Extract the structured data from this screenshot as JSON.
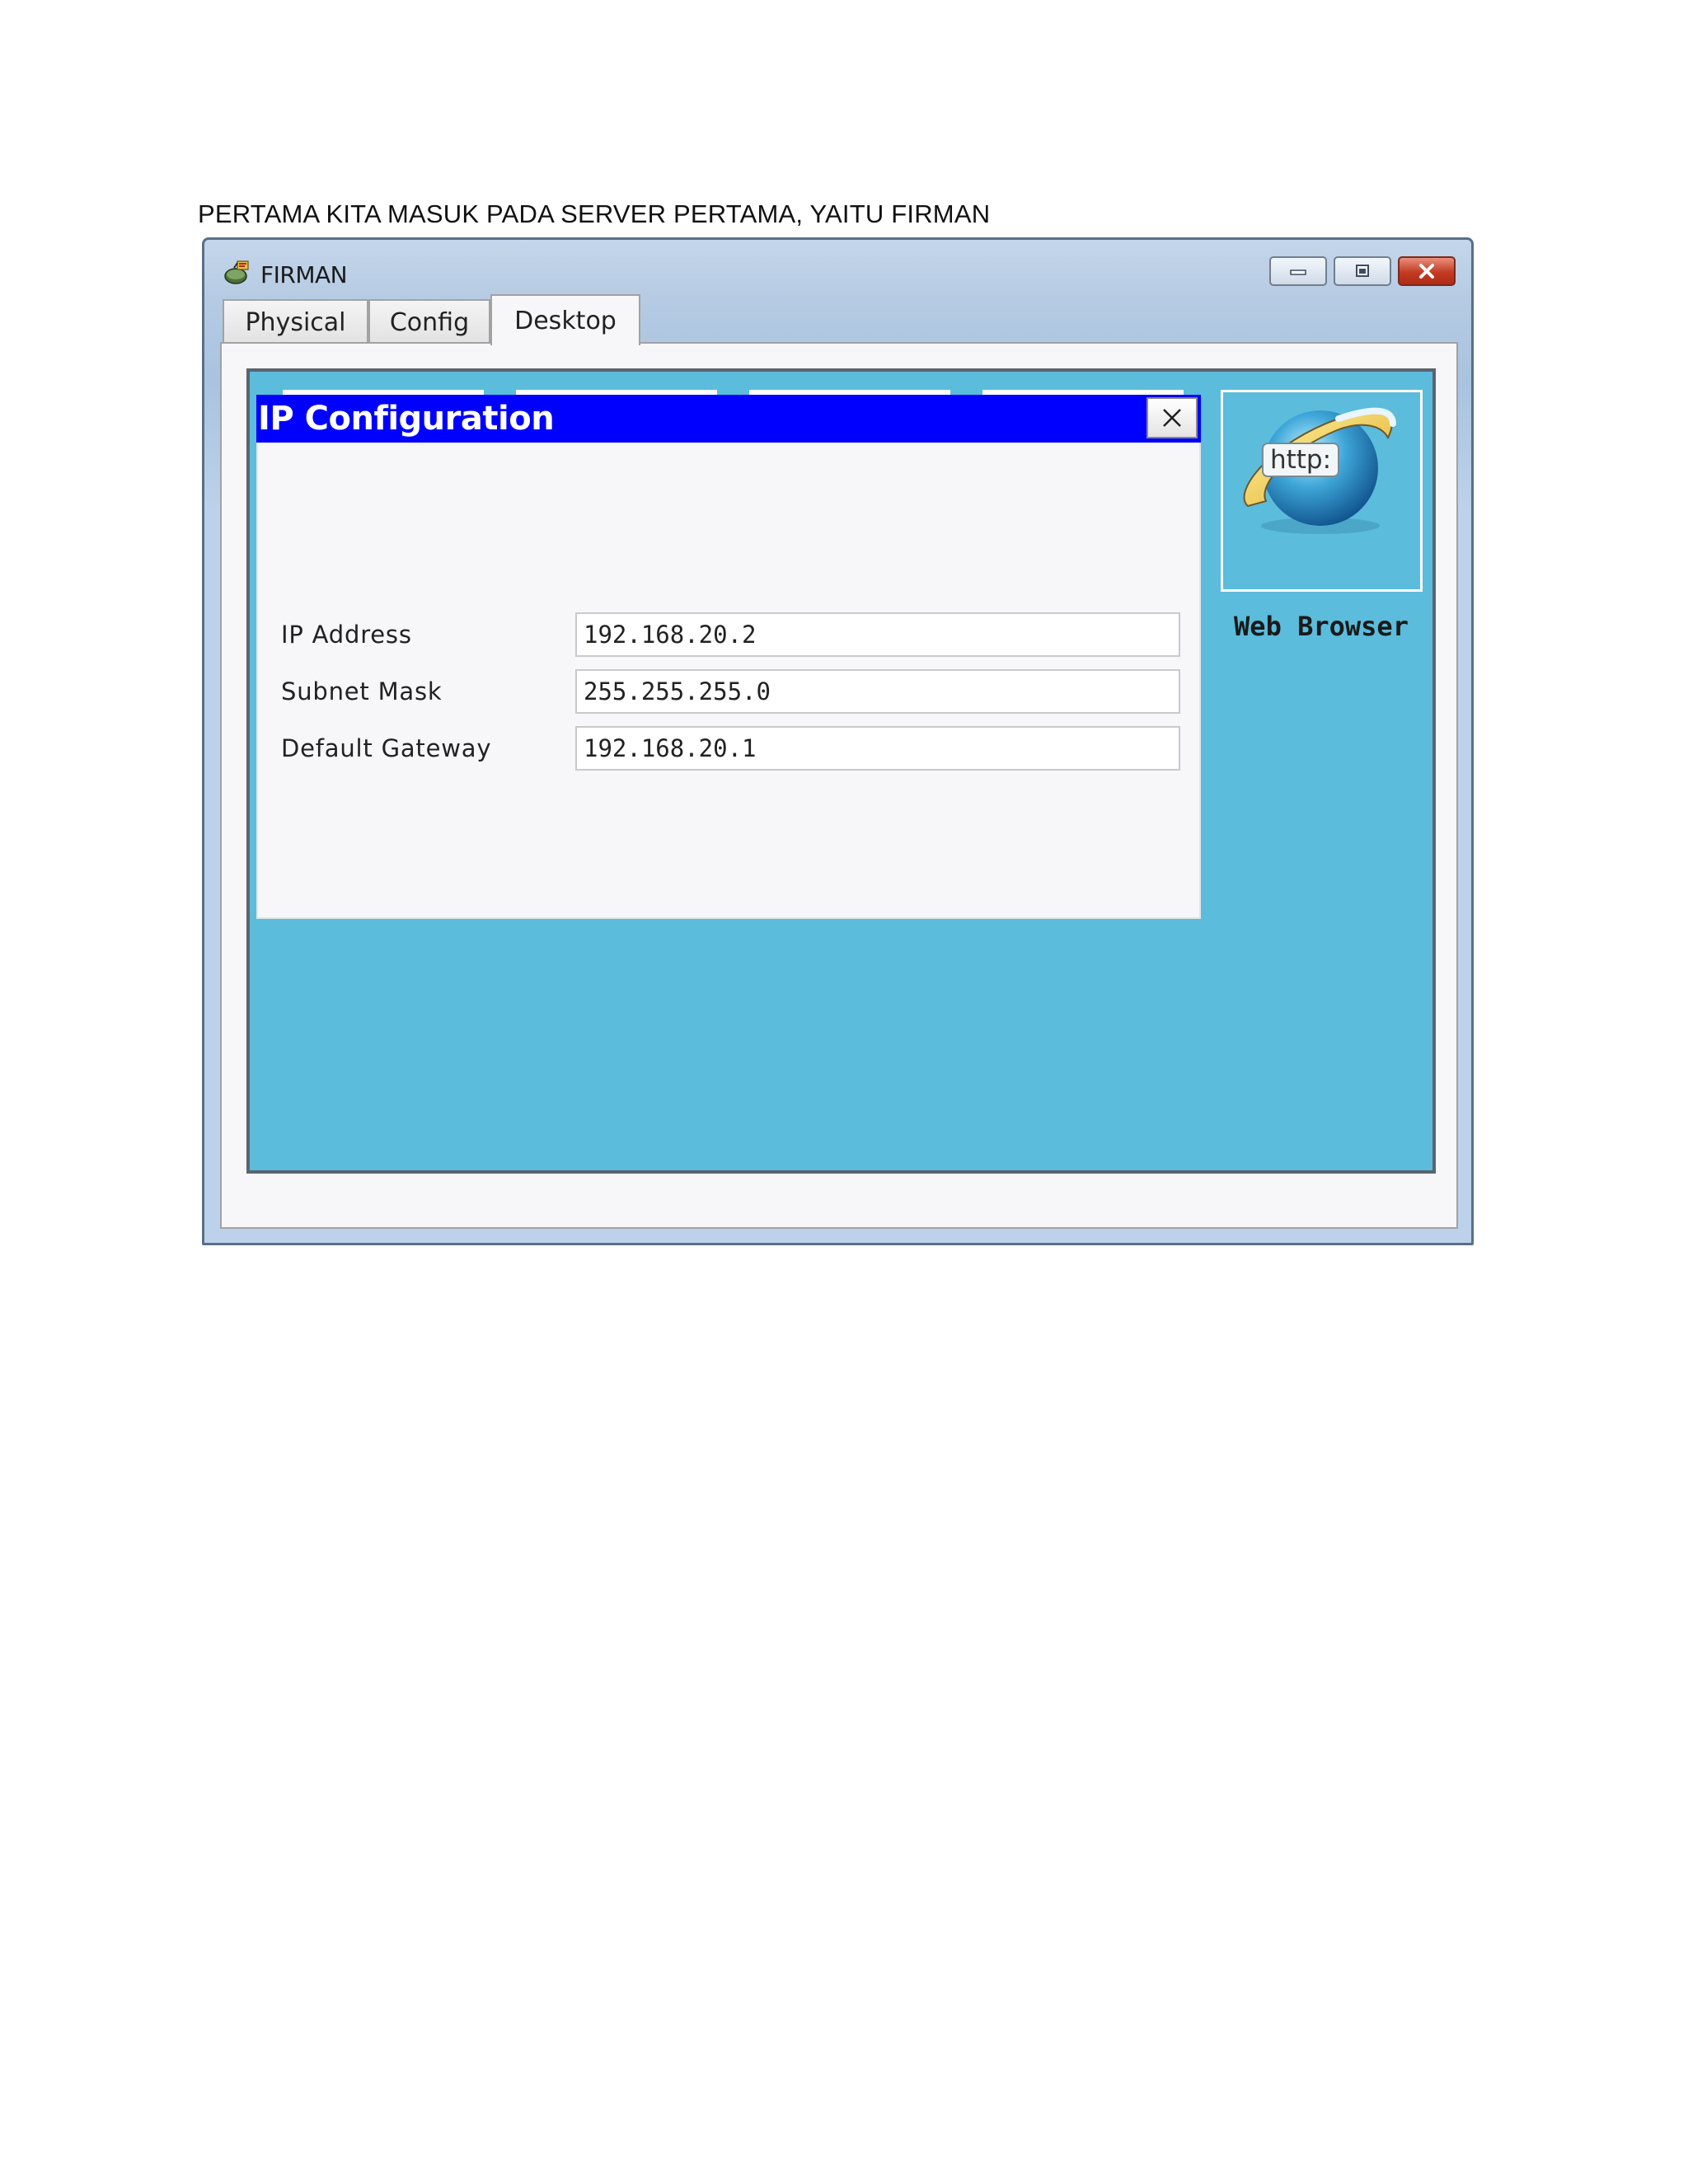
{
  "document": {
    "caption": "PERTAMA KITA MASUK PADA SERVER PERTAMA, YAITU FIRMAN"
  },
  "window": {
    "title": "FIRMAN",
    "controls": {
      "minimize": "minimize-icon",
      "maximize": "maximize-icon",
      "close": "close-icon"
    },
    "tabs": [
      {
        "label": "Physical",
        "active": false
      },
      {
        "label": "Config",
        "active": false
      },
      {
        "label": "Desktop",
        "active": true
      }
    ]
  },
  "desktop": {
    "background_color": "#5bbcdc",
    "ip_configuration": {
      "title": "IP Configuration",
      "title_bar_color": "#0000ff",
      "close_icon": "close-icon",
      "fields": [
        {
          "label": "IP Address",
          "value": "192.168.20.2"
        },
        {
          "label": "Subnet Mask",
          "value": "255.255.255.0"
        },
        {
          "label": "Default Gateway",
          "value": "192.168.20.1"
        }
      ]
    },
    "web_browser": {
      "icon": "http-globe-icon",
      "icon_text": "http:",
      "label": "Web Browser"
    }
  }
}
